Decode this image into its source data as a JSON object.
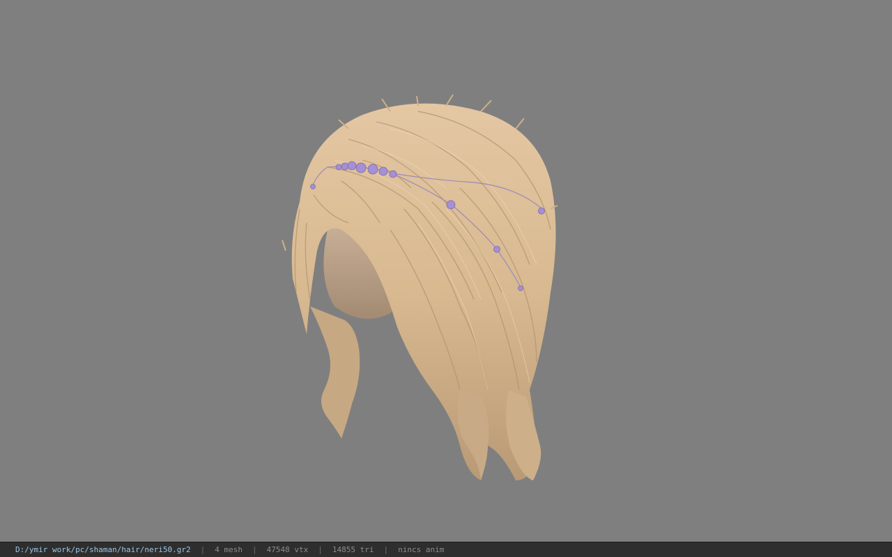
{
  "viewer": {
    "model_icon": "hair-model-icon",
    "background_color": "#7f7f7f"
  },
  "status": {
    "file_path": "D:/ymir work/pc/shaman/hair/neri50.gr2",
    "mesh_count": "4 mesh",
    "vertex_count": "47548 vtx",
    "triangle_count": "14855 tri",
    "animation_status": "nincs anim",
    "separator": "|"
  }
}
